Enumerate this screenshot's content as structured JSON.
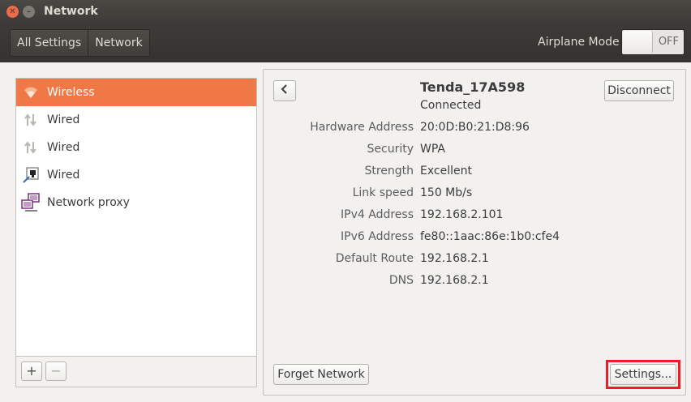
{
  "window": {
    "title": "Network"
  },
  "toolbar": {
    "breadcrumb": [
      "All Settings",
      "Network"
    ],
    "airplane_label": "Airplane Mode",
    "airplane_state": "OFF"
  },
  "connections": [
    {
      "label": "Wireless",
      "icon": "wifi-icon",
      "selected": true
    },
    {
      "label": "Wired",
      "icon": "wired-arrows-icon",
      "selected": false
    },
    {
      "label": "Wired",
      "icon": "wired-arrows-icon",
      "selected": false
    },
    {
      "label": "Wired",
      "icon": "network-device-icon",
      "selected": false
    },
    {
      "label": "Network proxy",
      "icon": "network-proxy-icon",
      "selected": false
    }
  ],
  "list_buttons": {
    "add": "+",
    "remove": "−"
  },
  "details": {
    "name": "Tenda_17A598",
    "status": "Connected",
    "disconnect_label": "Disconnect",
    "properties": [
      {
        "label": "Hardware Address",
        "value": "20:0D:B0:21:D8:96"
      },
      {
        "label": "Security",
        "value": "WPA"
      },
      {
        "label": "Strength",
        "value": "Excellent"
      },
      {
        "label": "Link speed",
        "value": "150 Mb/s"
      },
      {
        "label": "IPv4 Address",
        "value": "192.168.2.101"
      },
      {
        "label": "IPv6 Address",
        "value": "fe80::1aac:86e:1b0:cfe4"
      },
      {
        "label": "Default Route",
        "value": "192.168.2.1"
      },
      {
        "label": "DNS",
        "value": "192.168.2.1"
      }
    ],
    "forget_label": "Forget Network",
    "settings_label": "Settings..."
  },
  "colors": {
    "selection": "#f07746",
    "highlight_box": "#ee1c24",
    "titlebar": "#3c3b37"
  }
}
